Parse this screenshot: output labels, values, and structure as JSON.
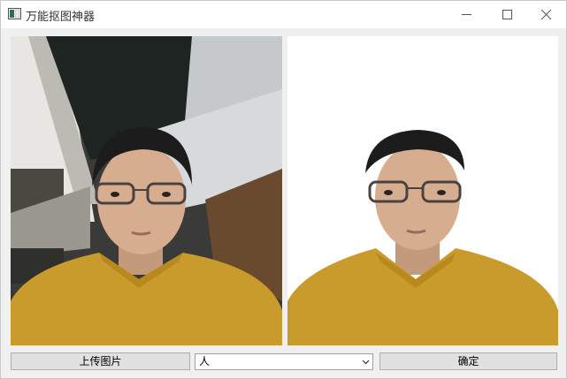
{
  "window": {
    "title": "万能抠图神器",
    "icon": "app-icon",
    "controls": [
      "minimize-icon",
      "maximize-icon",
      "close-icon"
    ]
  },
  "panes": {
    "original_image": "portrait-original",
    "result_image": "portrait-cutout"
  },
  "toolbar": {
    "upload_label": "上传图片",
    "category_value": "人",
    "confirm_label": "确定"
  }
}
